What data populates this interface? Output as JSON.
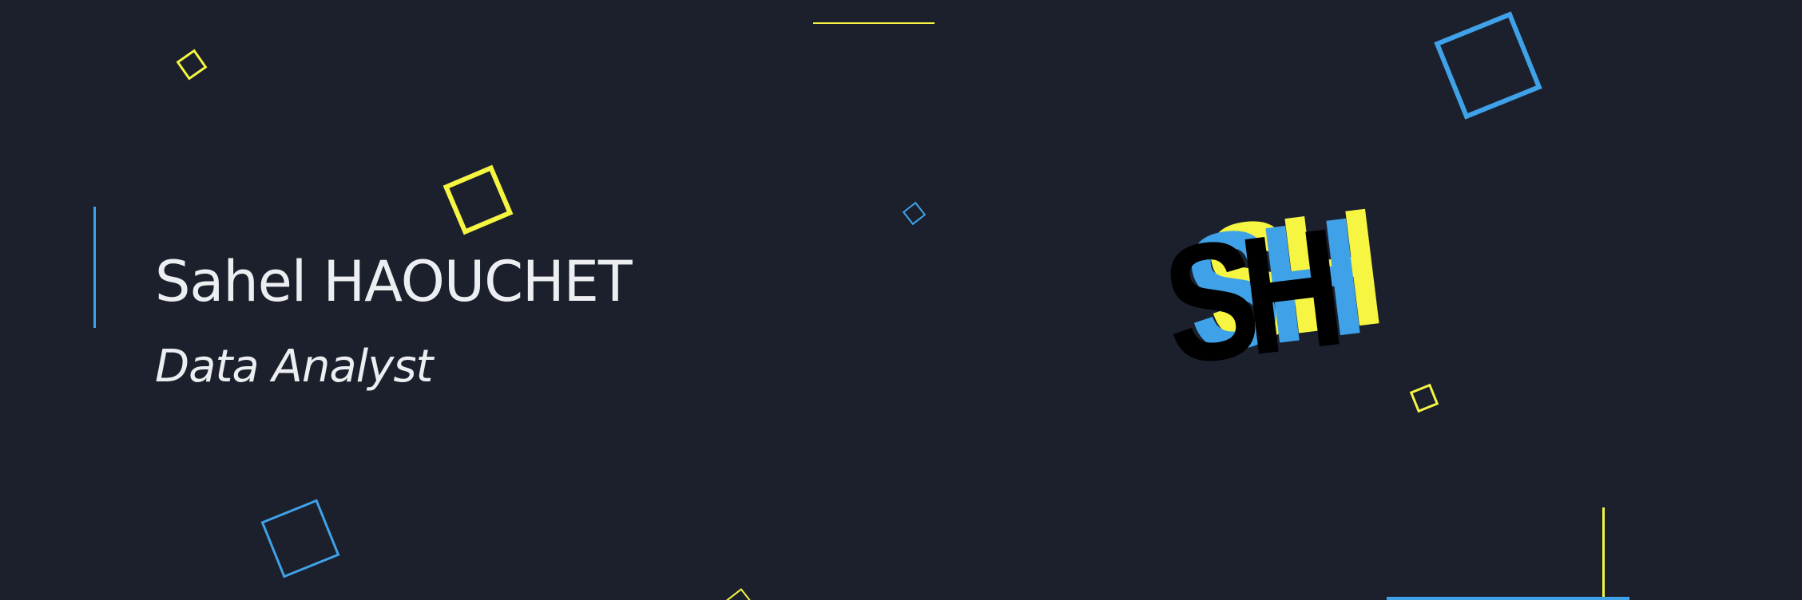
{
  "profile": {
    "name": "Sahel HAOUCHET",
    "role": "Data Analyst"
  },
  "logo": {
    "text": "SH",
    "colors": [
      "#f5f542",
      "#3fa2e8",
      "#000000"
    ]
  },
  "colors": {
    "background": "#1b202c",
    "text": "#eceef1",
    "accent_blue": "#3fa2e8",
    "accent_yellow": "#f5f542"
  }
}
